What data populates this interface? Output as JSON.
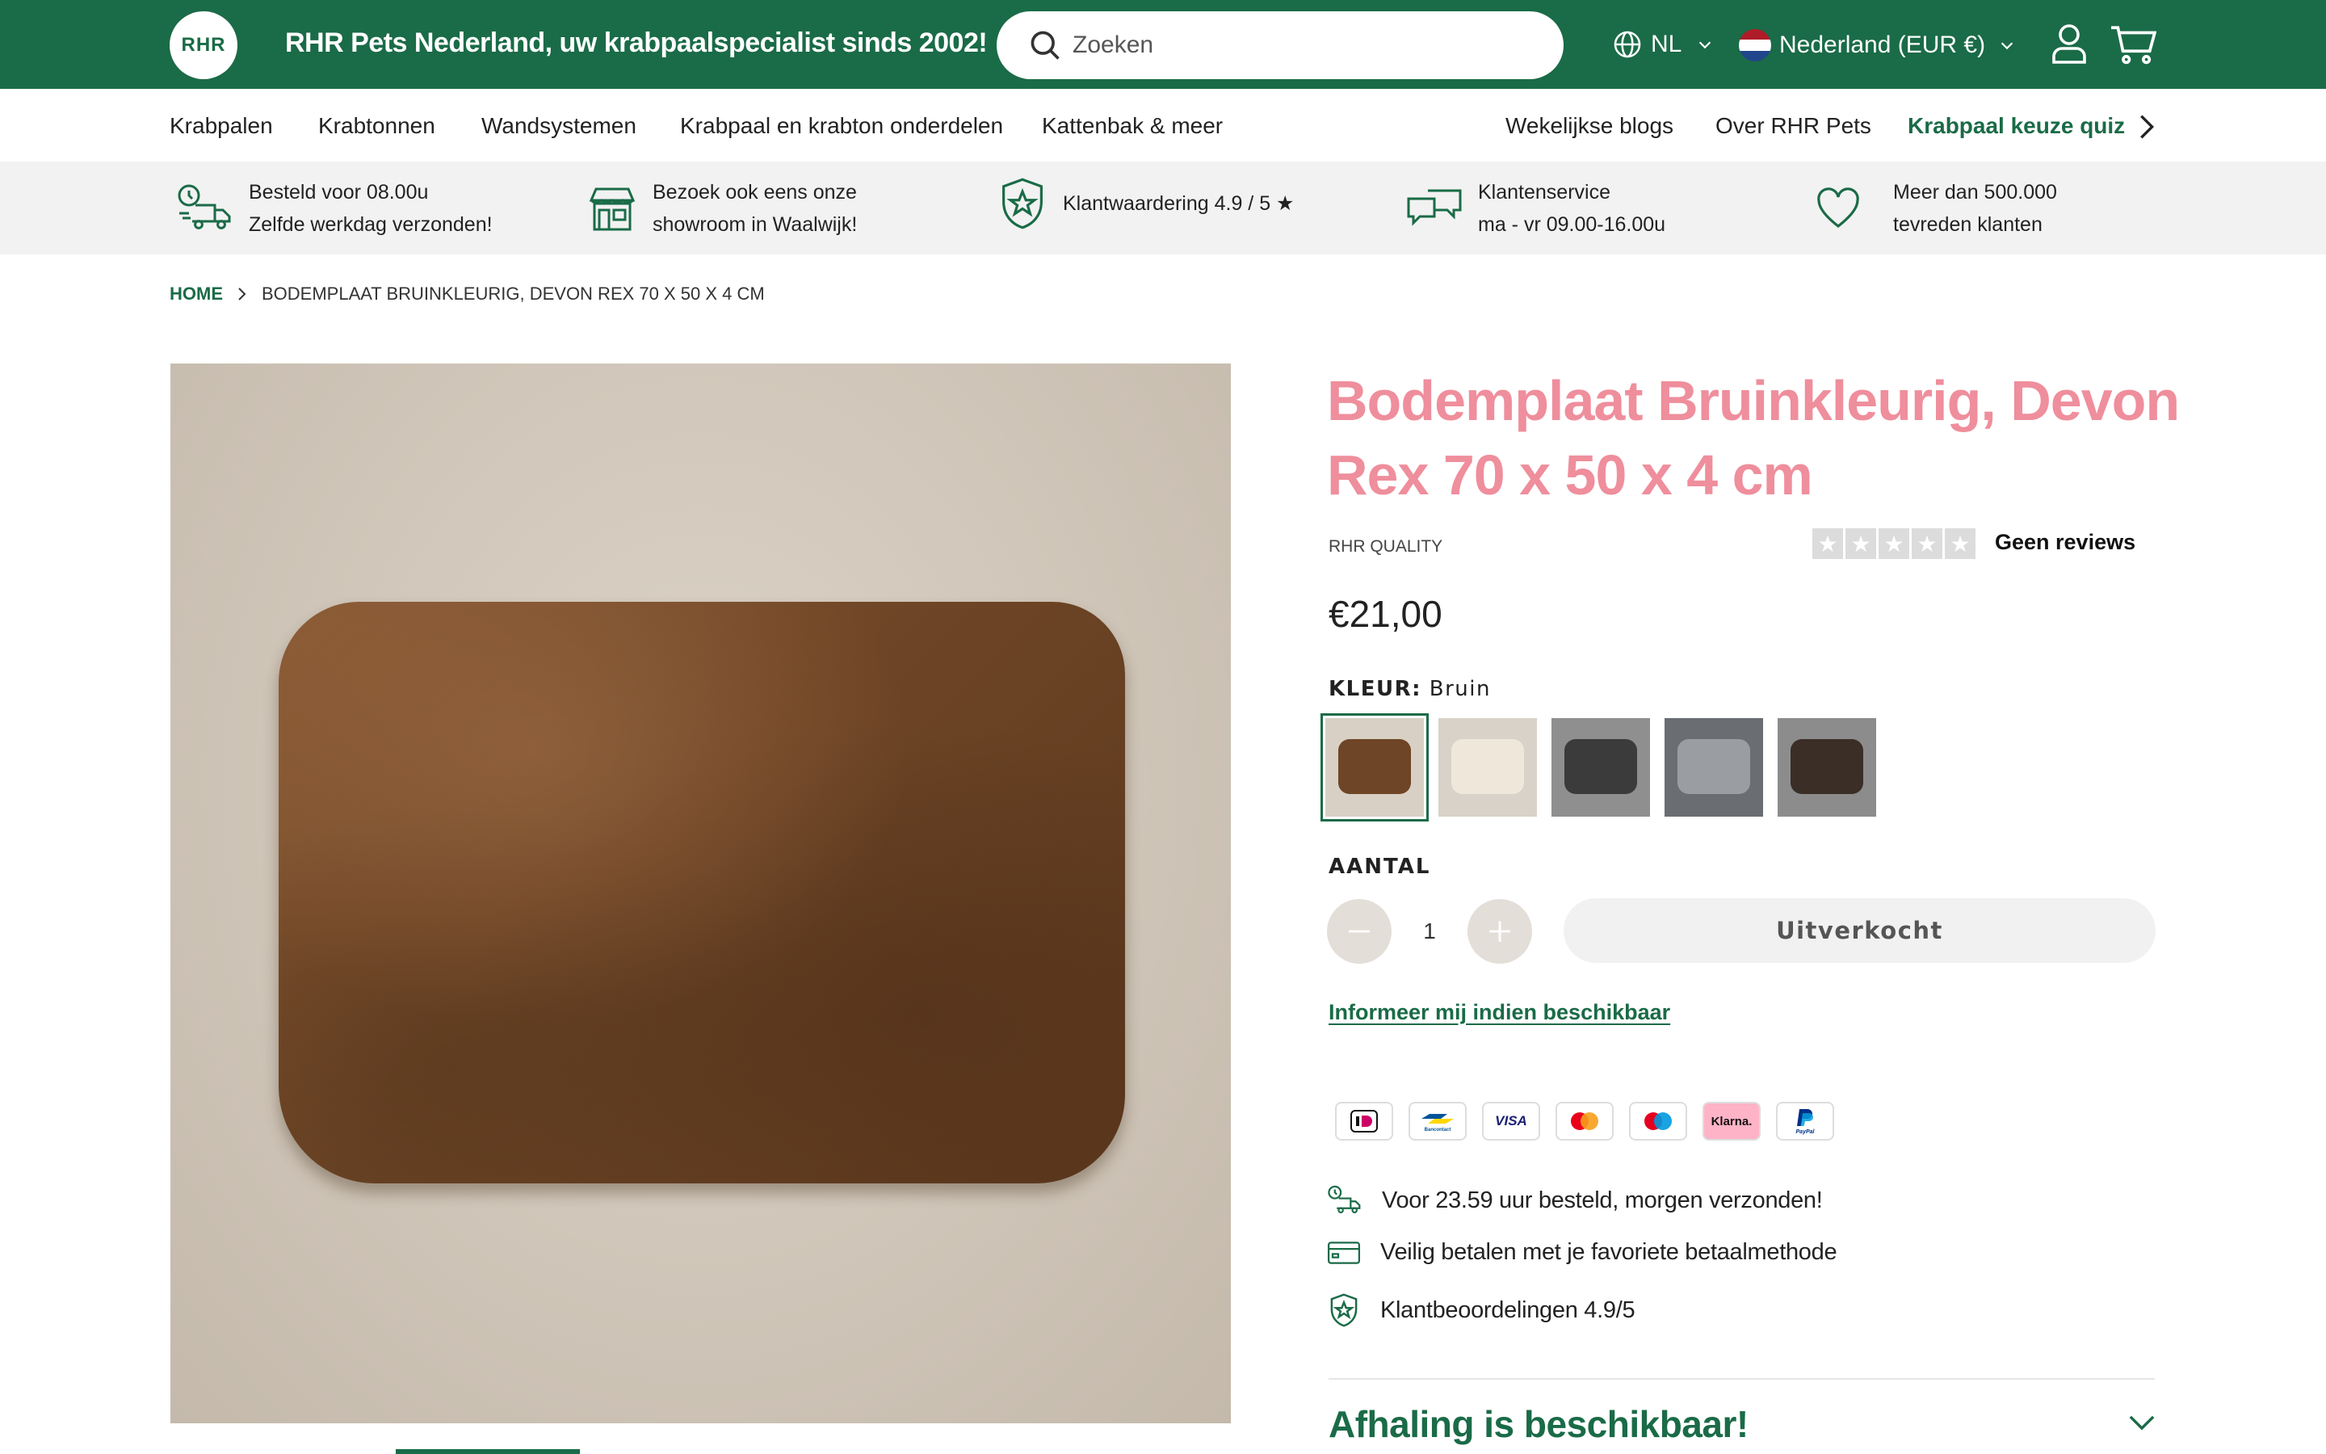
{
  "header": {
    "logo_text": "RHR",
    "tagline": "RHR Pets Nederland, uw krabpaalspecialist sinds 2002!",
    "search_placeholder": "Zoeken",
    "language": "NL",
    "country": "Nederland (EUR €)"
  },
  "nav": {
    "left": [
      "Krabpalen",
      "Krabtonnen",
      "Wandsystemen",
      "Krabpaal en krabton onderdelen",
      "Kattenbak & meer"
    ],
    "right": [
      "Wekelijkse blogs",
      "Over RHR Pets"
    ],
    "quiz": "Krabpaal keuze quiz"
  },
  "usp": [
    {
      "icon": "delivery-truck-icon",
      "line1": "Besteld voor 08.00u",
      "line2": "Zelfde werkdag verzonden!"
    },
    {
      "icon": "storefront-icon",
      "line1": "Bezoek ook eens onze",
      "line2": "showroom in Waalwijk!"
    },
    {
      "icon": "shield-star-icon",
      "line1": "Klantwaardering 4.9 / 5 ★",
      "line2": ""
    },
    {
      "icon": "chat-bubbles-icon",
      "line1": "Klantenservice",
      "line2": "ma - vr 09.00-16.00u"
    },
    {
      "icon": "heart-icon",
      "line1": "Meer dan 500.000",
      "line2": "tevreden klanten"
    }
  ],
  "breadcrumb": {
    "home": "HOME",
    "current": "BODEMPLAAT BRUINKLEURIG, DEVON REX 70 X 50 X 4 CM"
  },
  "product": {
    "title": "Bodemplaat Bruinkleurig, Devon Rex 70 x 50 x 4 cm",
    "brand": "RHR QUALITY",
    "rating_stars": 0,
    "reviews": "Geen reviews",
    "price": "€21,00",
    "color_label": "KLEUR:",
    "color_value": "Bruin",
    "swatch_colors": [
      "#6e4526",
      "#efe7da",
      "#3b3b3b",
      "#9a9ea3",
      "#3a2e27"
    ],
    "quantity_label": "AANTAL",
    "quantity": "1",
    "soldout_label": "Uitverkocht",
    "notify_label": "Informeer mij indien beschikbaar"
  },
  "payments": [
    "iDEAL",
    "Bancontact",
    "VISA",
    "Mastercard",
    "Maestro",
    "Klarna.",
    "PayPal"
  ],
  "features": [
    {
      "icon": "fast-delivery-icon",
      "text": "Voor 23.59 uur besteld, morgen verzonden!"
    },
    {
      "icon": "credit-card-icon",
      "text": "Veilig betalen met je favoriete betaalmethode"
    },
    {
      "icon": "shield-star-icon",
      "text": "Klantbeoordelingen 4.9/5"
    }
  ],
  "pickup": "Afhaling is beschikbaar!",
  "colors": {
    "brand_green": "#1a6b47",
    "title_pink": "#ef8e9c"
  }
}
